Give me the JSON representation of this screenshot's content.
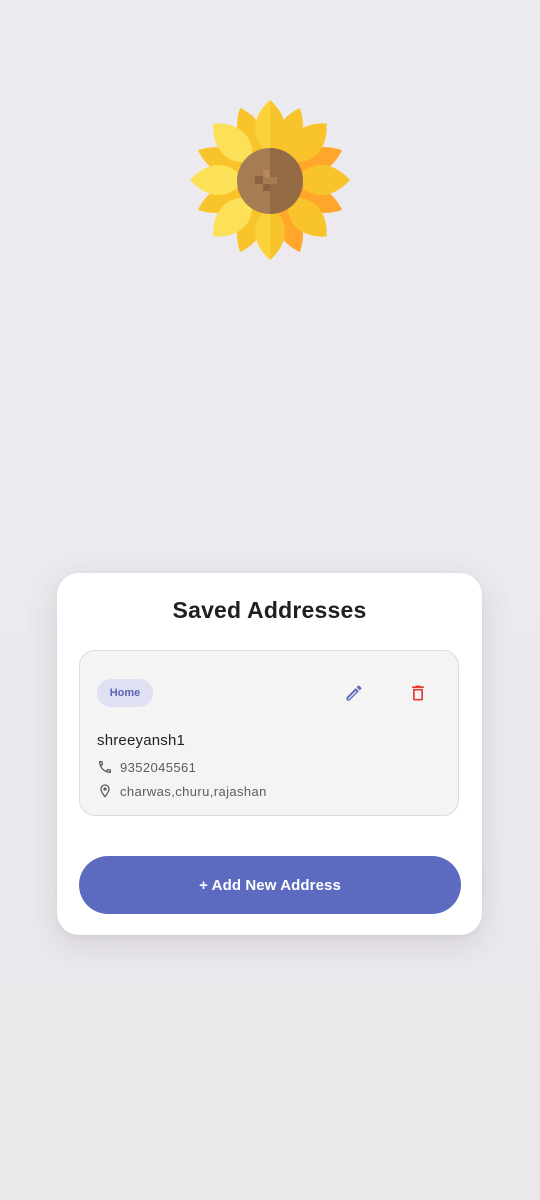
{
  "logo": {
    "icon": "sunflower-icon"
  },
  "saved_addresses": {
    "title": "Saved Addresses",
    "items": [
      {
        "tag": "Home",
        "name": "shreeyansh1",
        "phone": "9352045561",
        "address": "charwas,churu,rajashan",
        "edit_icon": "pencil-icon",
        "delete_icon": "trash-icon",
        "phone_icon": "phone-icon",
        "location_icon": "location-pin-icon"
      }
    ],
    "add_button_label": "+ Add New Address"
  },
  "colors": {
    "background": "#ECEBEF",
    "card": "#FFFFFF",
    "item_background": "#F4F4F5",
    "accent": "#5C6BC0",
    "badge_background": "#DFE0F1",
    "delete": "#E53935",
    "text_primary": "#1F1F24",
    "text_secondary": "#5C5C63"
  }
}
